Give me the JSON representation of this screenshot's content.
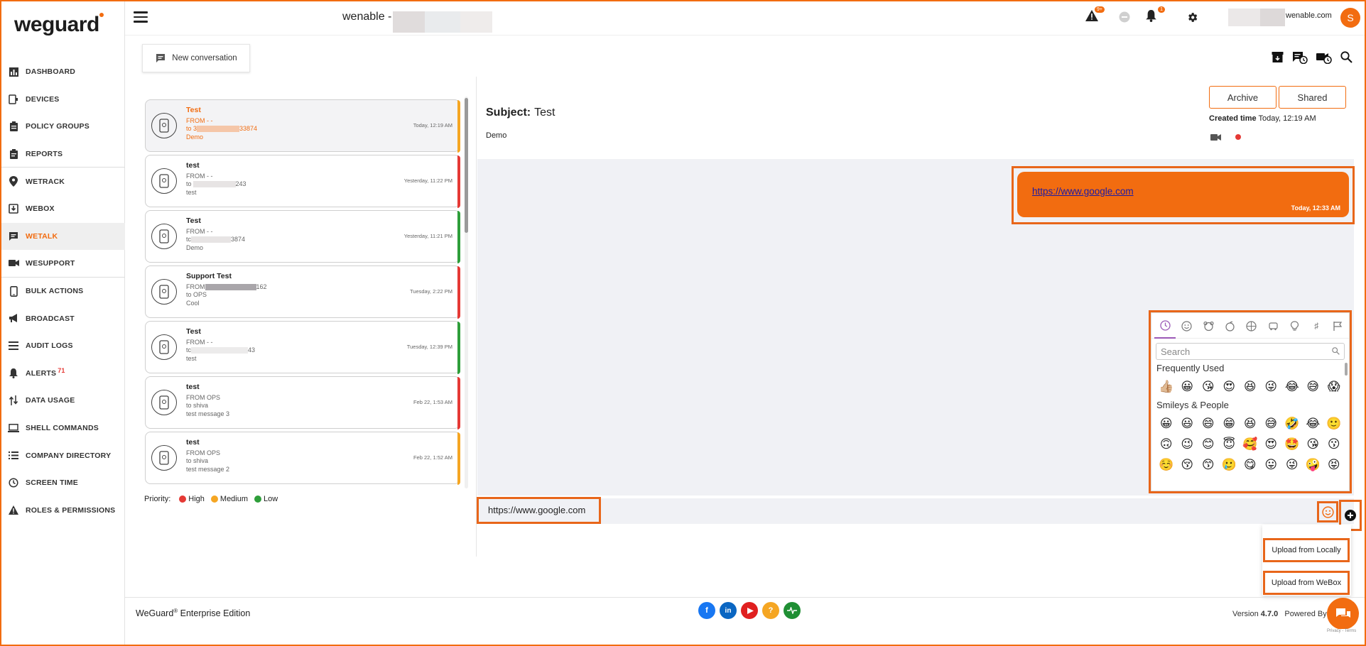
{
  "brand": {
    "logo_text": "weguard",
    "accent": "#f26c10"
  },
  "topbar": {
    "tenant_label": "wenable -",
    "alert_badge": "9+",
    "bell_badge": "1",
    "account_domain": "wenable.com",
    "avatar_initial": "S"
  },
  "nav": [
    {
      "label": "DASHBOARD",
      "icon": "chart-icon"
    },
    {
      "label": "DEVICES",
      "icon": "device-icon"
    },
    {
      "label": "POLICY GROUPS",
      "icon": "policy-icon"
    },
    {
      "label": "REPORTS",
      "icon": "report-icon"
    },
    {
      "label": "WETRACK",
      "icon": "location-pin-icon"
    },
    {
      "label": "WEBOX",
      "icon": "box-icon"
    },
    {
      "label": "WETALK",
      "icon": "chat-icon"
    },
    {
      "label": "WESUPPORT",
      "icon": "video-icon"
    },
    {
      "label": "BULK ACTIONS",
      "icon": "phone-icon"
    },
    {
      "label": "BROADCAST",
      "icon": "megaphone-icon"
    },
    {
      "label": "AUDIT LOGS",
      "icon": "list-icon"
    },
    {
      "label": "ALERTS",
      "icon": "bell-icon",
      "badge": "71"
    },
    {
      "label": "DATA USAGE",
      "icon": "transfer-icon"
    },
    {
      "label": "SHELL COMMANDS",
      "icon": "laptop-icon"
    },
    {
      "label": "COMPANY DIRECTORY",
      "icon": "directory-icon"
    },
    {
      "label": "SCREEN TIME",
      "icon": "history-icon"
    },
    {
      "label": "ROLES & PERMISSIONS",
      "icon": "warning-icon"
    }
  ],
  "new_conversation_label": "New conversation",
  "conversations": [
    {
      "title": "Test",
      "from": "FROM - -",
      "to": "to 3",
      "to_tail": "33874",
      "body": "Demo",
      "time": "Today, 12:19 AM",
      "priority_color": "#f5a623",
      "selected": true
    },
    {
      "title": "test",
      "from": "FROM - -",
      "to": "to",
      "to_tail": "243",
      "body": "test",
      "time": "Yesterday, 11:22 PM",
      "priority_color": "#e53935"
    },
    {
      "title": "Test",
      "from": "FROM - -",
      "to": "tc",
      "to_tail": "3874",
      "body": "Demo",
      "time": "Yesterday, 11:21 PM",
      "priority_color": "#2e9e3a"
    },
    {
      "title": "Support Test",
      "from": "FROM",
      "from_tail": "162",
      "to": "to OPS",
      "body": "Cool",
      "time": "Tuesday, 2:22 PM",
      "priority_color": "#e53935"
    },
    {
      "title": "Test",
      "from": "FROM - -",
      "to": "tc",
      "to_tail": "43",
      "body": "test",
      "time": "Tuesday, 12:39 PM",
      "priority_color": "#2e9e3a"
    },
    {
      "title": "test",
      "from": "FROM OPS",
      "to": "to shiva",
      "body": "test message 3",
      "time": "Feb 22, 1:53 AM",
      "priority_color": "#e53935"
    },
    {
      "title": "test",
      "from": "FROM OPS",
      "to": "to shiva",
      "body": "test message 2",
      "time": "Feb 22, 1:52 AM",
      "priority_color": "#f5a623"
    }
  ],
  "priority_legend": {
    "label": "Priority:",
    "items": [
      {
        "label": "High",
        "color": "#e53935"
      },
      {
        "label": "Medium",
        "color": "#f5a623"
      },
      {
        "label": "Low",
        "color": "#2e9e3a"
      }
    ]
  },
  "detail": {
    "subject_label": "Subject:",
    "subject": "Test",
    "body": "Demo",
    "archive_label": "Archive",
    "shared_label": "Shared",
    "created_label": "Created time",
    "created_value": "Today, 12:19 AM"
  },
  "message": {
    "link": "https://www.google.com",
    "time": "Today, 12:33 AM"
  },
  "emoji_picker": {
    "search_placeholder": "Search",
    "frequent_label": "Frequently Used",
    "smileys_label": "Smileys & People",
    "frequent": [
      "👍🏼",
      "😀",
      "😘",
      "😍",
      "😆",
      "😜",
      "😂",
      "😅",
      "😱"
    ],
    "smileys": [
      [
        "😀",
        "😃",
        "😄",
        "😁",
        "😆",
        "😅",
        "🤣",
        "😂",
        "🙂"
      ],
      [
        "🙃",
        "😉",
        "😊",
        "😇",
        "🥰",
        "😍",
        "🤩",
        "😘",
        "😗"
      ],
      [
        "☺️",
        "😚",
        "😙",
        "🥲",
        "😋",
        "😛",
        "😜",
        "🤪",
        "😝"
      ]
    ]
  },
  "composer": {
    "value": "https://www.google.com",
    "upload_local": "Upload from Locally",
    "upload_webox": "Upload from WeBox"
  },
  "footer": {
    "edition_prefix": "WeGuard",
    "edition_suffix": " Enterprise Edition",
    "version_label": "Version",
    "version": "4.7.0",
    "powered_by": "Powered By",
    "recaptcha": "Privacy - Terms"
  }
}
